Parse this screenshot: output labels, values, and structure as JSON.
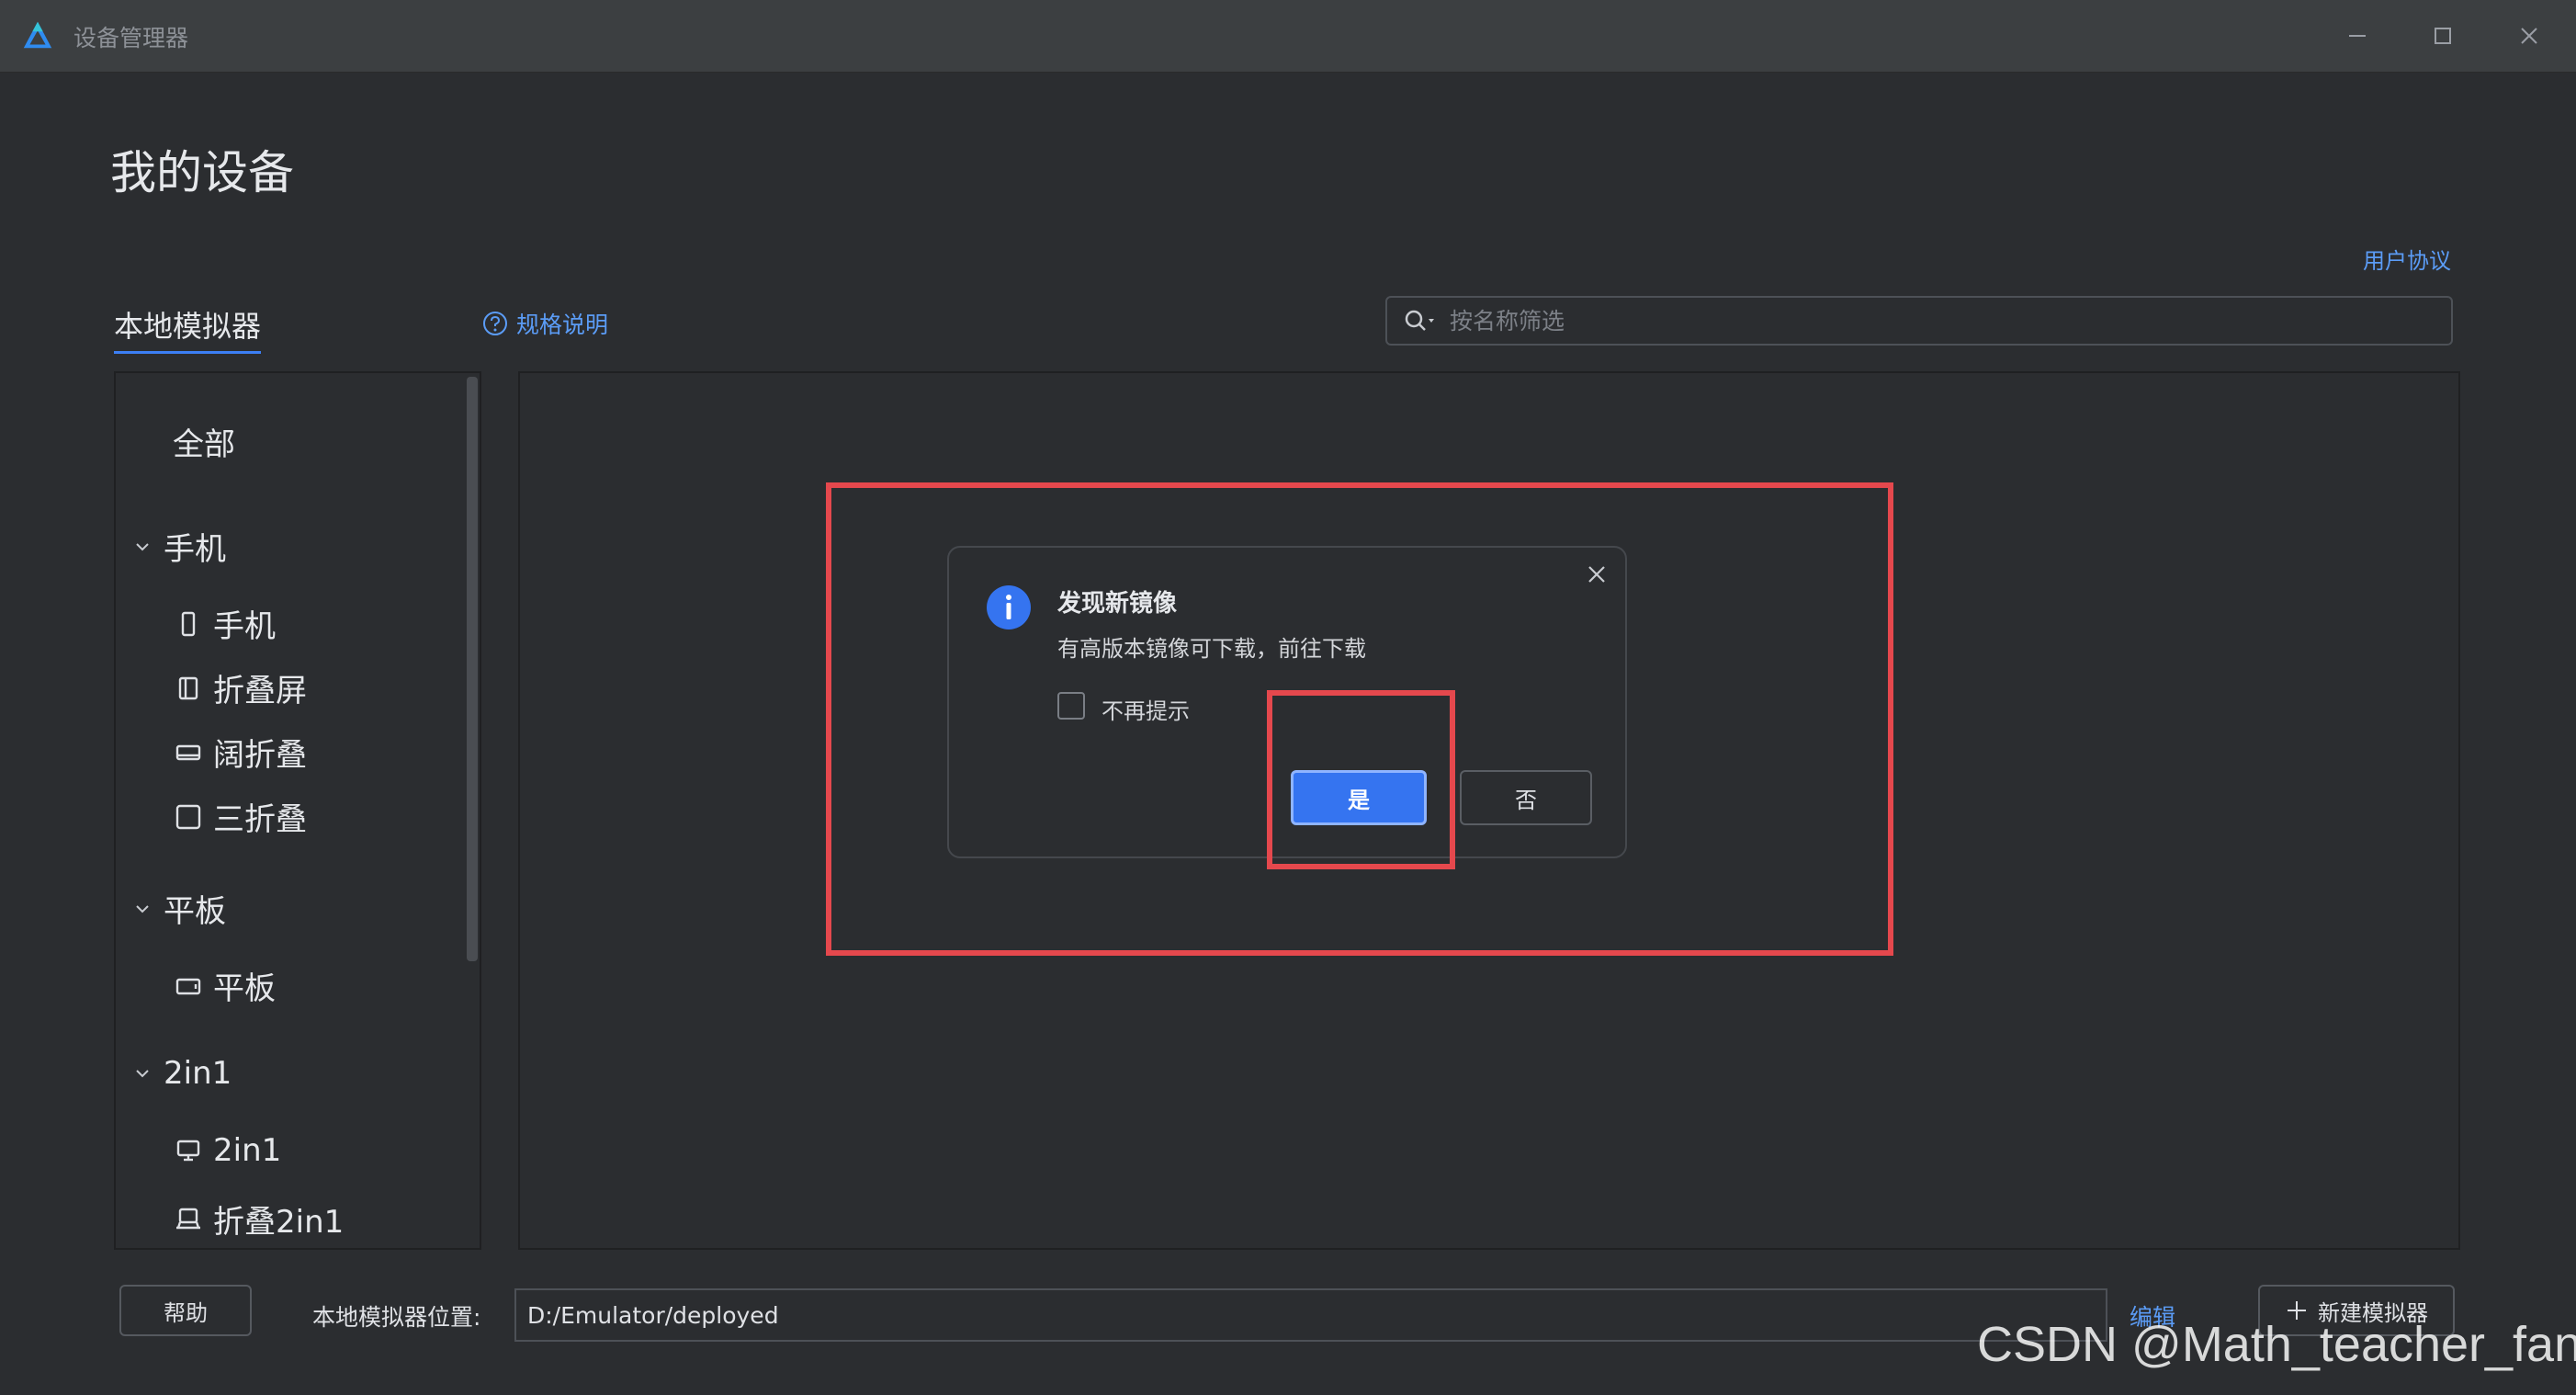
{
  "window": {
    "title": "设备管理器",
    "logo_icon": "harmony-devicemanager-logo-icon",
    "controls": [
      "minimize-icon",
      "maximize-icon",
      "close-icon"
    ]
  },
  "header": {
    "page_title": "我的设备",
    "user_agreement": "用户协议",
    "tab_local": "本地模拟器",
    "spec_link": "规格说明",
    "search_placeholder": "按名称筛选"
  },
  "sidebar": {
    "all": "全部",
    "groups": [
      {
        "label": "手机",
        "items": [
          "手机",
          "折叠屏",
          "阔折叠",
          "三折叠"
        ]
      },
      {
        "label": "平板",
        "items": [
          "平板"
        ]
      },
      {
        "label": "2in1",
        "items": [
          "2in1",
          "折叠2in1"
        ]
      }
    ]
  },
  "dialog": {
    "title": "发现新镜像",
    "message": "有高版本镜像可下载，前往下载",
    "checkbox_label": "不再提示",
    "checkbox_checked": false,
    "yes": "是",
    "no": "否"
  },
  "footer": {
    "help": "帮助",
    "path_label": "本地模拟器位置:",
    "path_value": "D:/Emulator/deployed",
    "edit": "编辑",
    "new_emulator": "新建模拟器"
  },
  "watermark": "CSDN @Math_teacher_fan",
  "colors": {
    "accent": "#3574f0",
    "link": "#5b9cf6",
    "highlight": "#e5484d",
    "background": "#2b2d30"
  }
}
